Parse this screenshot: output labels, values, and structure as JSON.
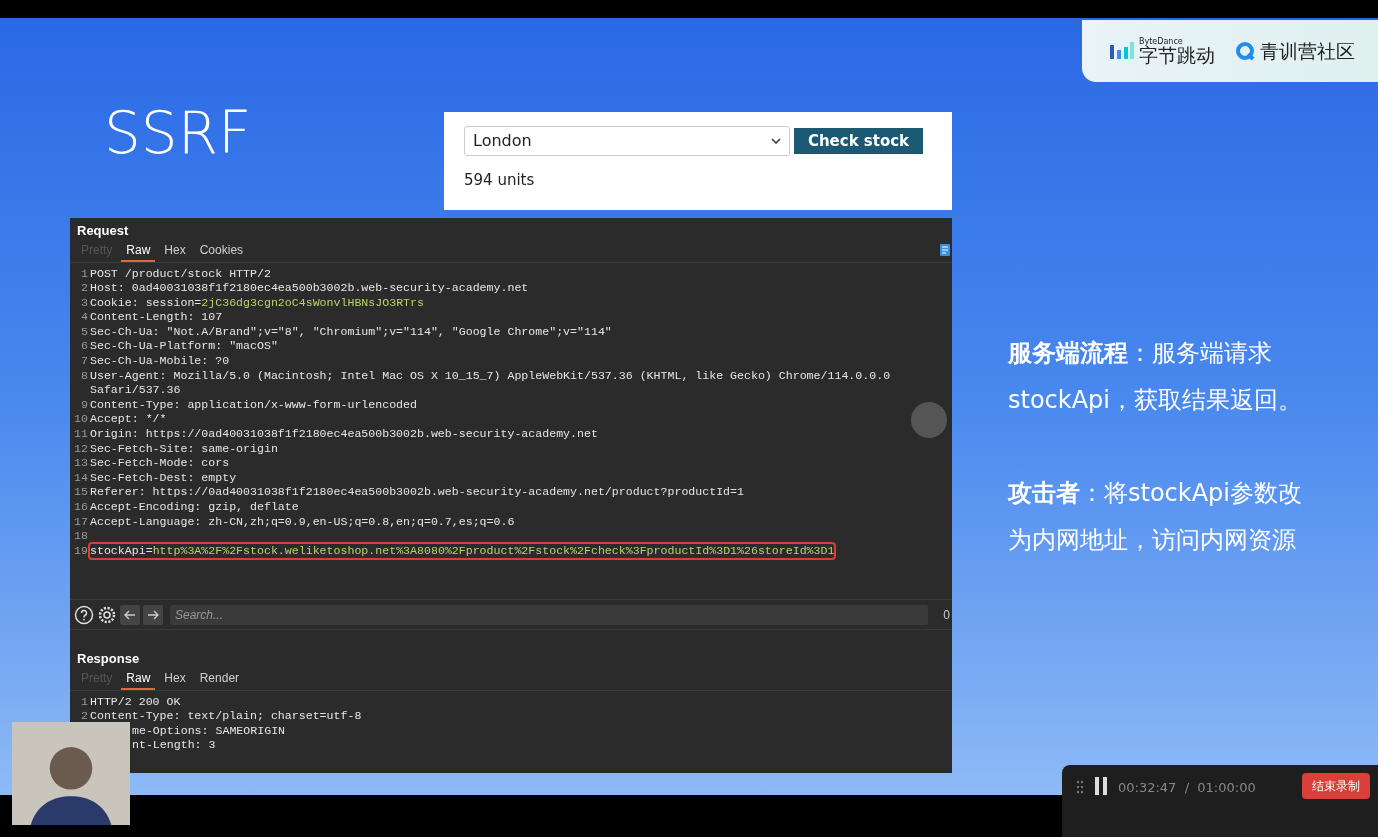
{
  "logos": {
    "bytedance_small": "ByteDance",
    "bytedance": "字节跳动",
    "community": "青训营社区"
  },
  "slide_title": "SSRF",
  "stock_widget": {
    "select_value": "London",
    "button": "Check stock",
    "result": "594 units"
  },
  "request": {
    "title": "Request",
    "tabs": [
      {
        "label": "Pretty",
        "selected": false,
        "disabled": true
      },
      {
        "label": "Raw",
        "selected": true,
        "disabled": false
      },
      {
        "label": "Hex",
        "selected": false,
        "disabled": false
      },
      {
        "label": "Cookies",
        "selected": false,
        "disabled": false
      }
    ],
    "lines": [
      {
        "num": "1",
        "text": "POST /product/stock HTTP/2",
        "boxed": false
      },
      {
        "num": "2",
        "text": "Host: 0ad40031038f1f2180ec4ea500b3002b.web-security-academy.net",
        "boxed": false
      },
      {
        "num": "3",
        "text": "Cookie: session=",
        "highlight": "2jC36dg3cgn2oC4sWonvlHBNsJO3RTrs",
        "boxed": false
      },
      {
        "num": "4",
        "text": "Content-Length: 107",
        "boxed": false
      },
      {
        "num": "5",
        "text": "Sec-Ch-Ua: \"Not.A/Brand\";v=\"8\", \"Chromium\";v=\"114\", \"Google Chrome\";v=\"114\"",
        "boxed": false
      },
      {
        "num": "6",
        "text": "Sec-Ch-Ua-Platform: \"macOS\"",
        "boxed": false
      },
      {
        "num": "7",
        "text": "Sec-Ch-Ua-Mobile: ?0",
        "boxed": false
      },
      {
        "num": "8",
        "text": "User-Agent: Mozilla/5.0 (Macintosh; Intel Mac OS X 10_15_7) AppleWebKit/537.36 (KHTML, like Gecko) Chrome/114.0.0.0 Safari/537.36",
        "boxed": false
      },
      {
        "num": "9",
        "text": "Content-Type: application/x-www-form-urlencoded",
        "boxed": false
      },
      {
        "num": "10",
        "text": "Accept: */*",
        "boxed": false
      },
      {
        "num": "11",
        "text": "Origin: https://0ad40031038f1f2180ec4ea500b3002b.web-security-academy.net",
        "boxed": false
      },
      {
        "num": "12",
        "text": "Sec-Fetch-Site: same-origin",
        "boxed": false
      },
      {
        "num": "13",
        "text": "Sec-Fetch-Mode: cors",
        "boxed": false
      },
      {
        "num": "14",
        "text": "Sec-Fetch-Dest: empty",
        "boxed": false
      },
      {
        "num": "15",
        "text": "Referer: https://0ad40031038f1f2180ec4ea500b3002b.web-security-academy.net/product?productId=1",
        "boxed": false
      },
      {
        "num": "16",
        "text": "Accept-Encoding: gzip, deflate",
        "boxed": false
      },
      {
        "num": "17",
        "text": "Accept-Language: zh-CN,zh;q=0.9,en-US;q=0.8,en;q=0.7,es;q=0.6",
        "boxed": false
      },
      {
        "num": "18",
        "boxed": false
      },
      {
        "num": "19",
        "text": "stockApi=",
        "highlight": "http%3A%2F%2Fstock.weliketoshop.net%3A8080%2Fproduct%2Fstock%2Fcheck%3FproductId%3D1%26storeId%3D1",
        "boxed": true
      }
    ]
  },
  "search": {
    "placeholder": "Search...",
    "count": "0"
  },
  "response": {
    "title": "Response",
    "tabs": [
      {
        "label": "Pretty",
        "selected": false,
        "disabled": true
      },
      {
        "label": "Raw",
        "selected": true,
        "disabled": false
      },
      {
        "label": "Hex",
        "selected": false,
        "disabled": false
      },
      {
        "label": "Render",
        "selected": false,
        "disabled": false
      }
    ],
    "lines": [
      {
        "num": "1",
        "text": "HTTP/2 200 OK"
      },
      {
        "num": "2",
        "text": "Content-Type: text/plain; charset=utf-8"
      },
      {
        "text": "me-Options: SAMEORIGIN"
      },
      {
        "text": "nt-Length: 3"
      }
    ]
  },
  "notes": [
    "**服务端流程**：服务端请求stockApi，获取结果返回。",
    "**攻击者**：将stockApi参数改为内网地址，访问内网资源"
  ],
  "recorder": {
    "time": "00:32:47  /  01:00:00",
    "button": "结束录制"
  }
}
